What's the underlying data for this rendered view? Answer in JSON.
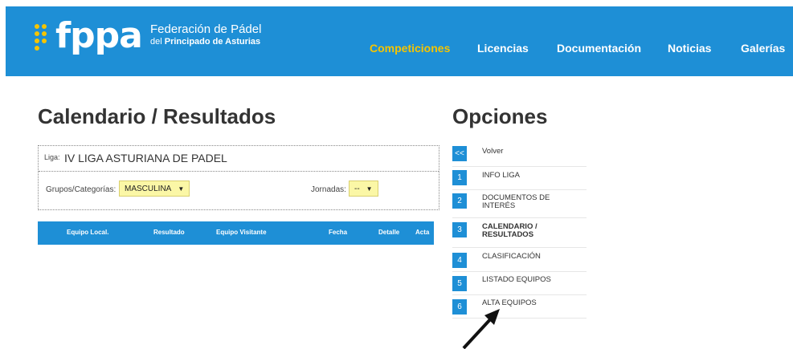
{
  "header": {
    "logo_text": "fppa",
    "logo_line1": "Federación de Pádel",
    "logo_line2_prefix": "del ",
    "logo_line2_bold": "Principado de Asturias",
    "nav": [
      {
        "label": "Competiciones",
        "active": true
      },
      {
        "label": "Licencias",
        "active": false
      },
      {
        "label": "Documentación",
        "active": false
      },
      {
        "label": "Noticias",
        "active": false
      },
      {
        "label": "Galerías",
        "active": false
      }
    ]
  },
  "main": {
    "title": "Calendario / Resultados",
    "liga_label": "Liga:",
    "liga_value": "IV LIGA ASTURIANA DE PADEL",
    "grupos_label": "Grupos/Categorías:",
    "grupos_value": "MASCULINA",
    "jornadas_label": "Jornadas:",
    "jornadas_value": "--",
    "table_headers": [
      "Equipo Local.",
      "Resultado",
      "Equipo Visitante",
      "Fecha",
      "Detalle",
      "Acta"
    ]
  },
  "options": {
    "title": "Opciones",
    "items": [
      {
        "num": "<<",
        "label": "Volver"
      },
      {
        "num": "1",
        "label": "INFO LIGA"
      },
      {
        "num": "2",
        "label": "DOCUMENTOS DE INTERÉS"
      },
      {
        "num": "3",
        "label": "CALENDARIO / RESULTADOS"
      },
      {
        "num": "4",
        "label": "CLASIFICACIÓN"
      },
      {
        "num": "5",
        "label": "LISTADO EQUIPOS"
      },
      {
        "num": "6",
        "label": "ALTA EQUIPOS"
      }
    ]
  },
  "colors": {
    "brand_blue": "#1e8fd6",
    "accent_yellow": "#f5c400",
    "select_bg": "#fbf7a6"
  },
  "icons": [
    "logo-dots-icon",
    "chevron-down-icon",
    "pointer-arrow-icon"
  ]
}
